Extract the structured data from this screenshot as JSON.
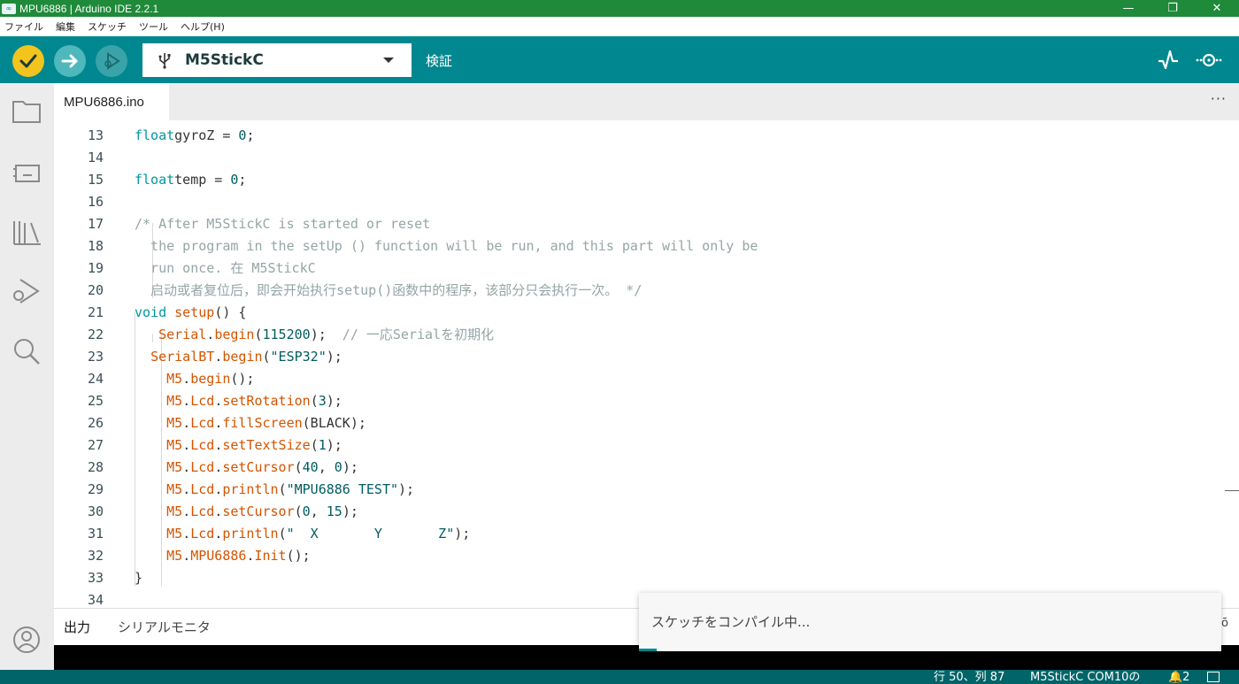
{
  "window": {
    "title": "MPU6886 | Arduino IDE 2.2.1",
    "app_icon": "∞",
    "minimize": "—",
    "restore": "❐",
    "close": "✕"
  },
  "menu": [
    "ファイル",
    "編集",
    "スケッチ",
    "ツール",
    "ヘルプ(H)"
  ],
  "toolbar": {
    "board": "M5StickC",
    "verify_label": "検証",
    "colors": {
      "toolbar": "#00878f",
      "verify": "#f2c41d",
      "upload": "#4fb8bd"
    }
  },
  "tabs": {
    "active": "MPU6886.ino",
    "more": "···"
  },
  "code": {
    "lines": [
      {
        "n": "13",
        "segs": [
          [
            "kw",
            "float"
          ],
          [
            "",
            "gyroZ = "
          ],
          [
            "num",
            "0"
          ],
          [
            "",
            ";"
          ]
        ]
      },
      {
        "n": "14",
        "segs": []
      },
      {
        "n": "15",
        "segs": [
          [
            "kw",
            "float"
          ],
          [
            "",
            "temp = "
          ],
          [
            "num",
            "0"
          ],
          [
            "",
            ";"
          ]
        ]
      },
      {
        "n": "16",
        "segs": []
      },
      {
        "n": "17",
        "segs": [
          [
            "cm",
            "/* After M5StickC is started or reset"
          ]
        ]
      },
      {
        "n": "18",
        "segs": [
          [
            "cm",
            "  the program in the setUp () function will be run, and this part will only be"
          ]
        ]
      },
      {
        "n": "19",
        "segs": [
          [
            "cm",
            "  run once. 在 M5StickC"
          ]
        ]
      },
      {
        "n": "20",
        "segs": [
          [
            "cm",
            "  启动或者复位后，即会开始执行setup()函数中的程序，该部分只会执行一次。 */"
          ]
        ]
      },
      {
        "n": "21",
        "segs": [
          [
            "kw",
            "void"
          ],
          [
            "",
            " "
          ],
          [
            "fn",
            "setup"
          ],
          [
            "",
            "() {"
          ]
        ]
      },
      {
        "n": "22",
        "segs": [
          [
            "",
            "   "
          ],
          [
            "fn",
            "Serial"
          ],
          [
            "",
            "."
          ],
          [
            "fn",
            "begin"
          ],
          [
            "",
            "("
          ],
          [
            "num",
            "115200"
          ],
          [
            "",
            "); "
          ],
          [
            "cm",
            " // 一応Serialを初期化"
          ]
        ]
      },
      {
        "n": "23",
        "segs": [
          [
            "",
            "  "
          ],
          [
            "fn",
            "SerialBT"
          ],
          [
            "",
            "."
          ],
          [
            "fn",
            "begin"
          ],
          [
            "",
            "("
          ],
          [
            "str",
            "\"ESP32\""
          ],
          [
            "",
            ");"
          ]
        ]
      },
      {
        "n": "24",
        "segs": [
          [
            "",
            "    "
          ],
          [
            "fn",
            "M5"
          ],
          [
            "",
            "."
          ],
          [
            "fn",
            "begin"
          ],
          [
            "",
            "();"
          ]
        ]
      },
      {
        "n": "25",
        "segs": [
          [
            "",
            "    "
          ],
          [
            "fn",
            "M5"
          ],
          [
            "",
            "."
          ],
          [
            "fn",
            "Lcd"
          ],
          [
            "",
            "."
          ],
          [
            "fn",
            "setRotation"
          ],
          [
            "",
            "("
          ],
          [
            "num",
            "3"
          ],
          [
            "",
            ");"
          ]
        ]
      },
      {
        "n": "26",
        "segs": [
          [
            "",
            "    "
          ],
          [
            "fn",
            "M5"
          ],
          [
            "",
            "."
          ],
          [
            "fn",
            "Lcd"
          ],
          [
            "",
            "."
          ],
          [
            "fn",
            "fillScreen"
          ],
          [
            "",
            "(BLACK);"
          ]
        ]
      },
      {
        "n": "27",
        "segs": [
          [
            "",
            "    "
          ],
          [
            "fn",
            "M5"
          ],
          [
            "",
            "."
          ],
          [
            "fn",
            "Lcd"
          ],
          [
            "",
            "."
          ],
          [
            "fn",
            "setTextSize"
          ],
          [
            "",
            "("
          ],
          [
            "num",
            "1"
          ],
          [
            "",
            ");"
          ]
        ]
      },
      {
        "n": "28",
        "segs": [
          [
            "",
            "    "
          ],
          [
            "fn",
            "M5"
          ],
          [
            "",
            "."
          ],
          [
            "fn",
            "Lcd"
          ],
          [
            "",
            "."
          ],
          [
            "fn",
            "setCursor"
          ],
          [
            "",
            "("
          ],
          [
            "num",
            "40"
          ],
          [
            "",
            ", "
          ],
          [
            "num",
            "0"
          ],
          [
            "",
            ");"
          ]
        ]
      },
      {
        "n": "29",
        "segs": [
          [
            "",
            "    "
          ],
          [
            "fn",
            "M5"
          ],
          [
            "",
            "."
          ],
          [
            "fn",
            "Lcd"
          ],
          [
            "",
            "."
          ],
          [
            "fn",
            "println"
          ],
          [
            "",
            "("
          ],
          [
            "str",
            "\"MPU6886 TEST\""
          ],
          [
            "",
            ");"
          ]
        ]
      },
      {
        "n": "30",
        "segs": [
          [
            "",
            "    "
          ],
          [
            "fn",
            "M5"
          ],
          [
            "",
            "."
          ],
          [
            "fn",
            "Lcd"
          ],
          [
            "",
            "."
          ],
          [
            "fn",
            "setCursor"
          ],
          [
            "",
            "("
          ],
          [
            "num",
            "0"
          ],
          [
            "",
            ", "
          ],
          [
            "num",
            "15"
          ],
          [
            "",
            ");"
          ]
        ]
      },
      {
        "n": "31",
        "segs": [
          [
            "",
            "    "
          ],
          [
            "fn",
            "M5"
          ],
          [
            "",
            "."
          ],
          [
            "fn",
            "Lcd"
          ],
          [
            "",
            "."
          ],
          [
            "fn",
            "println"
          ],
          [
            "",
            "("
          ],
          [
            "str",
            "\"  X       Y       Z\""
          ],
          [
            "",
            ");"
          ]
        ]
      },
      {
        "n": "32",
        "segs": [
          [
            "",
            "    "
          ],
          [
            "fn",
            "M5"
          ],
          [
            "",
            "."
          ],
          [
            "fn",
            "MPU6886"
          ],
          [
            "",
            "."
          ],
          [
            "fn",
            "Init"
          ],
          [
            "",
            "();"
          ]
        ]
      },
      {
        "n": "33",
        "segs": [
          [
            "",
            "}"
          ]
        ]
      },
      {
        "n": "34",
        "segs": []
      }
    ]
  },
  "panel": {
    "output": "出力",
    "serial_monitor": "シリアルモニタ"
  },
  "toast": {
    "message": "スケッチをコンパイル中...",
    "progress": 0.03,
    "edge_glyph": "ō"
  },
  "status": {
    "position": "行 50、列 87",
    "board_port": "M5StickC COM10の",
    "notifications": "🔔2"
  }
}
